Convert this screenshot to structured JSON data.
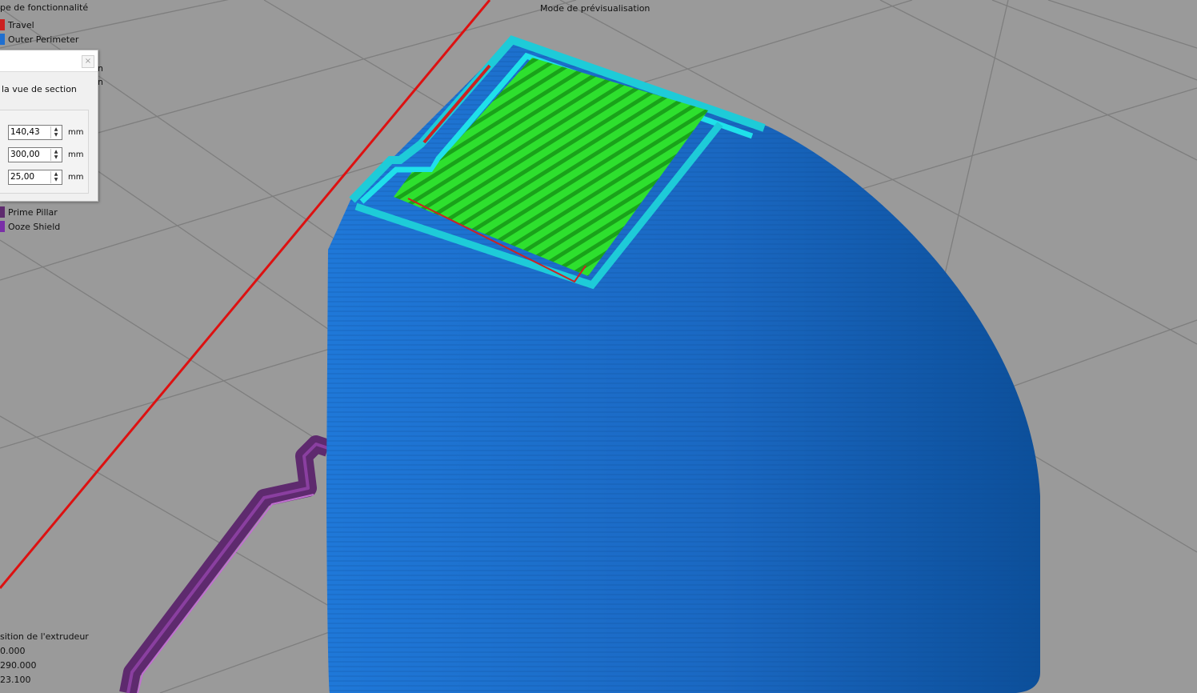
{
  "viewport": {
    "mode_label": "Mode de prévisualisation",
    "legend_title": "pe de fonctionnalité",
    "legend_items_top": [
      {
        "label": "Travel",
        "color": "#cc2222"
      },
      {
        "label": "Outer Perimeter",
        "color": "#1f6fd0"
      }
    ],
    "legend_items_bottom": [
      {
        "label": "Prime Pillar",
        "color": "#5e2a6e"
      },
      {
        "label": "Ooze Shield",
        "color": "#7a2fa8"
      }
    ],
    "hidden_legend_fragments": [
      "n",
      "n"
    ],
    "extruder": {
      "title": "sition de l'extrudeur",
      "x": "0.000",
      "y": "290.000",
      "z": "23.100"
    },
    "colors": {
      "background": "#9a9a9a",
      "grid": "#7e7e7e",
      "axis_red": "#dd1111",
      "outer_perimeter": "#1f6fd0",
      "inner_perimeter": "#1ecbd8",
      "infill": "#22dd22",
      "prime_pillar": "#5e2a6e"
    }
  },
  "section_dialog": {
    "description": "la vue de section",
    "close_icon": "close-icon",
    "fields": [
      {
        "value": "140,43",
        "unit": "mm"
      },
      {
        "value": "300,00",
        "unit": "mm"
      },
      {
        "value": "25,00",
        "unit": "mm"
      }
    ]
  }
}
